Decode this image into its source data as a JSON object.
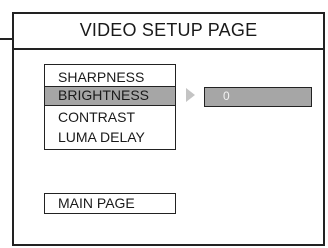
{
  "page": {
    "title": "VIDEO SETUP PAGE"
  },
  "menu": {
    "items": [
      {
        "label": "SHARPNESS",
        "selected": false
      },
      {
        "label": "BRIGHTNESS",
        "selected": true
      },
      {
        "label": "CONTRAST",
        "selected": false
      },
      {
        "label": "LUMA DELAY",
        "selected": false
      }
    ]
  },
  "submenu": {
    "value": "0",
    "arrow_icon": "triangle-right-icon"
  },
  "footer": {
    "main_page_label": "MAIN PAGE"
  },
  "colors": {
    "highlight": "#a6a6a6",
    "border": "#222222",
    "value_text": "#f2f2f2"
  }
}
